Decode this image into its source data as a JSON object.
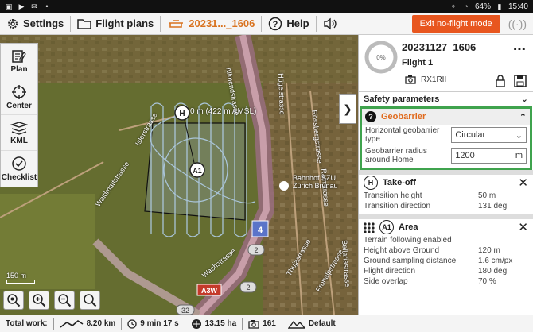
{
  "status_bar": {
    "time": "15:40",
    "battery": "64%"
  },
  "toolbar": {
    "settings_label": "Settings",
    "flight_plans_label": "Flight plans",
    "mission_label": "20231..._1606",
    "help_label": "Help",
    "exit_label": "Exit no-flight mode"
  },
  "tools": {
    "plan": "Plan",
    "center": "Center",
    "kml": "KML",
    "checklist": "Checklist"
  },
  "map": {
    "home_label": "0 m (422 m AMSL)",
    "area_label": "A1",
    "home_marker": "H",
    "scale": "150 m",
    "streets": {
      "s1": "Islerstrasse",
      "s2": "Waldmattstrasse",
      "s3": "Allmendstrasse",
      "s4": "Hügelstrasse",
      "s5": "Rossbergstrasse",
      "s6": "Rainstrasse",
      "s7": "Bahnhof SZU Zürich Brunau",
      "s8": "Thujastrasse",
      "s9": "Bellariastrasse",
      "s10": "Wachstrasse",
      "s11": "Frohalpstrasse"
    },
    "shields": {
      "a3w": "A3W",
      "r4": "4",
      "r2a": "2",
      "r2b": "2",
      "r32": "32"
    }
  },
  "panel": {
    "mission_name": "20231127_1606",
    "flight_name": "Flight 1",
    "progress": "0%",
    "camera": "RX1RII",
    "safety_title": "Safety parameters",
    "geobarrier": {
      "title": "Geobarrier",
      "type_label": "Horizontal geobarrier type",
      "type_value": "Circular",
      "radius_label": "Geobarrier radius around Home",
      "radius_value": "1200",
      "radius_unit": "m"
    },
    "takeoff": {
      "title": "Take-off",
      "marker": "H",
      "rows": [
        {
          "k": "Transition height",
          "v": "50 m"
        },
        {
          "k": "Transition direction",
          "v": "131 deg"
        }
      ]
    },
    "area": {
      "title": "Area",
      "marker": "A1",
      "rows": [
        {
          "k": "Terrain following enabled",
          "v": ""
        },
        {
          "k": "Height above Ground",
          "v": "120 m"
        },
        {
          "k": "Ground sampling distance",
          "v": "1.6 cm/px"
        },
        {
          "k": "Flight direction",
          "v": "180 deg"
        },
        {
          "k": "Side overlap",
          "v": "70 %"
        }
      ]
    }
  },
  "bottom_bar": {
    "total_label": "Total work:",
    "distance": "8.20 km",
    "duration": "9 min 17 s",
    "area": "13.15 ha",
    "photos": "161",
    "terrain_mode": "Default"
  },
  "colors": {
    "accent_orange": "#e8561f",
    "mission_orange": "#d9731f",
    "geobarrier_green": "#3fa34d"
  }
}
